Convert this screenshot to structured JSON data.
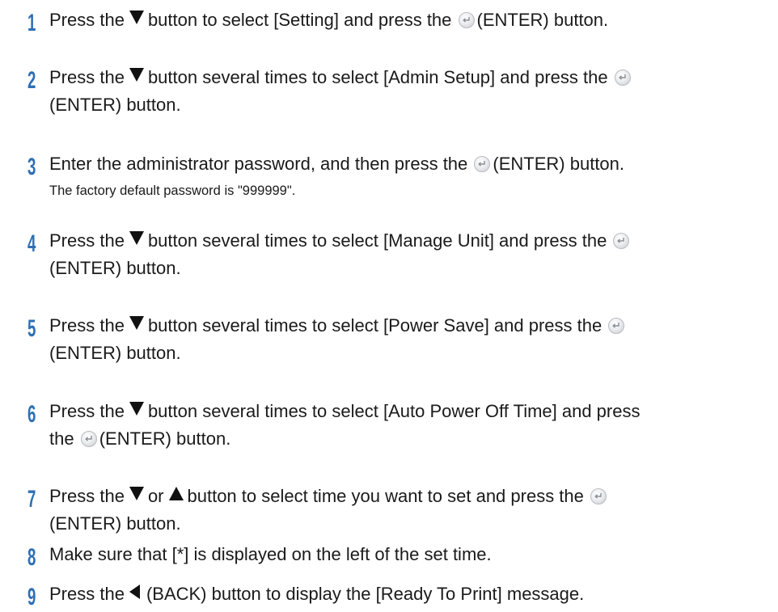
{
  "steps": [
    {
      "number": "1",
      "p1": "Press the",
      "p2": "button to select [Setting] and press the",
      "p3": "(ENTER) button."
    },
    {
      "number": "2",
      "p1": "Press the",
      "p2": "button several times to select [Admin Setup] and press the",
      "p3": "(ENTER) button."
    },
    {
      "number": "3",
      "p1": "Enter the administrator password, and then press the",
      "p2": "(ENTER) button.",
      "note": "The factory default password is \"999999\"."
    },
    {
      "number": "4",
      "p1": "Press the",
      "p2": "button several times to select [Manage Unit] and press the",
      "p3": "(ENTER) button."
    },
    {
      "number": "5",
      "p1": "Press the",
      "p2": "button several times to select [Power Save] and press the",
      "p3": "(ENTER) button."
    },
    {
      "number": "6",
      "p1": "Press the",
      "p2": "button several times to select [Auto Power Off Time] and press",
      "p3": "the",
      "p4": "(ENTER) button."
    },
    {
      "number": "7",
      "p1": "Press the",
      "p2": "or",
      "p3": "button to select time you want to set and press the",
      "p4": "(ENTER) button."
    },
    {
      "number": "8",
      "p1": "Make sure that [*] is displayed on the left of the set time."
    },
    {
      "number": "9",
      "p1": "Press the",
      "p2": "(BACK) button to display the [Ready To Print] message."
    }
  ],
  "icons": {
    "down": "down-arrow-icon",
    "up": "up-arrow-icon",
    "back": "back-arrow-icon",
    "enter": "enter-button-icon"
  },
  "colors": {
    "step_number": "#2f6fb3",
    "text": "#1a1a1a"
  }
}
